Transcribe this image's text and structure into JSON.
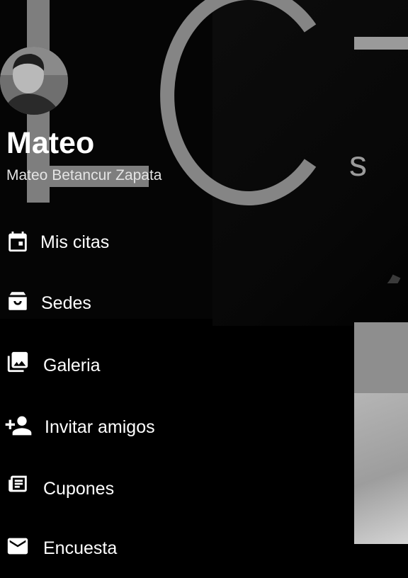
{
  "drawer": {
    "user": {
      "name": "Mateo",
      "full_name": "Mateo Betancur Zapata"
    },
    "menu": [
      {
        "label": "Mis citas",
        "icon": "calendar-icon"
      },
      {
        "label": "Sedes",
        "icon": "inbox-icon"
      },
      {
        "label": "Galeria",
        "icon": "gallery-icon"
      },
      {
        "label": "Invitar amigos",
        "icon": "person-add-icon"
      },
      {
        "label": "Cupones",
        "icon": "newspaper-icon"
      },
      {
        "label": "Encuesta",
        "icon": "mail-icon"
      }
    ]
  },
  "background": {
    "logo_letter_s": "s"
  },
  "colors": {
    "drawer_bg": "#000000",
    "text": "#ffffff",
    "logo_gray": "#7e7e7e"
  }
}
